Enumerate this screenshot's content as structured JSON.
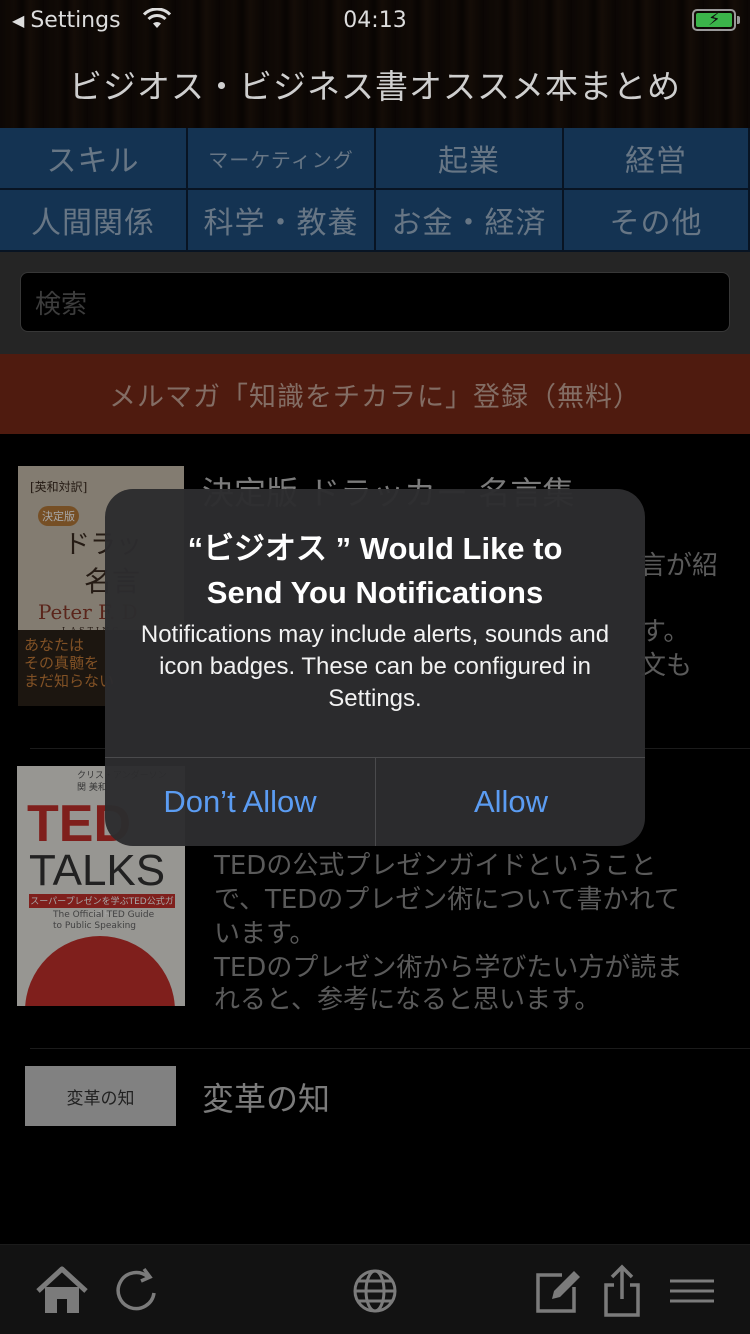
{
  "status_bar": {
    "back_label": "Settings",
    "time": "04:13"
  },
  "header": {
    "title": "ビジオス・ビジネス書オススメ本まとめ"
  },
  "categories": [
    {
      "label": "スキル"
    },
    {
      "label": "マーケティング"
    },
    {
      "label": "起業"
    },
    {
      "label": "経営"
    },
    {
      "label": "人間関係"
    },
    {
      "label": "科学・教養"
    },
    {
      "label": "お金・経済"
    },
    {
      "label": "その他"
    }
  ],
  "search": {
    "placeholder": "検索"
  },
  "banner": {
    "label": "メルマガ「知識をチカラに」登録（無料）"
  },
  "books": [
    {
      "title": "決定版 ドラッカー 名言集",
      "desc_lines": [
        "言が紹",
        "す。",
        "文も"
      ],
      "cover": {
        "tag": "[英和対訳]",
        "badge": "決定版",
        "big": "ドラッ",
        "big2": "名言",
        "author": "Peter F. D",
        "lasting": "LASTING",
        "band_lines": [
          "あなたは",
          "その真髄を",
          "まだ知らない"
        ]
      }
    },
    {
      "title": "",
      "desc_lines": [
        "TEDの公式プレゼンガイドということ",
        "で、TEDのプレゼン術について書かれて",
        "います。",
        "TEDのプレゼン術から学びたい方が読ま",
        "れると、参考になると思います。"
      ],
      "cover": {
        "top_line1": "クリス・アンダーソン",
        "top_line2": "関 美和",
        "ted": "TED",
        "talks": "TALKS",
        "strip": "スーパープレゼンを学ぶTED公式ガイド",
        "sub_line1": "The Official TED Guide",
        "sub_line2": "to Public Speaking"
      }
    },
    {
      "title": "変革の知",
      "cover": {
        "text": "変革の知"
      }
    }
  ],
  "alert": {
    "title_line1": "“ビジオス ” Would Like to",
    "title_line2": "Send You Notifications",
    "message": "Notifications may include alerts, sounds and icon badges. These can be configured in Settings.",
    "deny_label": "Don’t Allow",
    "allow_label": "Allow"
  },
  "tabbar": {
    "icons": [
      "home-icon",
      "refresh-icon",
      "globe-icon",
      "compose-icon",
      "share-icon",
      "menu-icon"
    ]
  },
  "colors": {
    "category_bg": "#1f4f7e",
    "banner_bg": "#7a2a18",
    "alert_button": "#5b9cf2"
  }
}
